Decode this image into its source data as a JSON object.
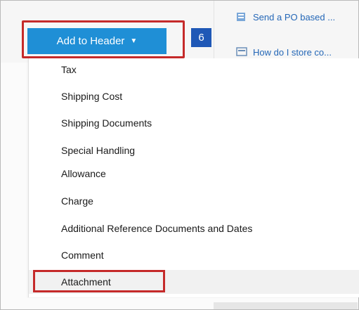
{
  "toolbar": {
    "add_to_header_label": "Add to Header",
    "caret_glyph": "▼",
    "step_number": "6"
  },
  "help_links": [
    {
      "label": "Send a PO based ...",
      "icon": "document-icon"
    },
    {
      "label": "How do I store co...",
      "icon": "image-icon"
    }
  ],
  "menu": {
    "items": [
      {
        "label": "Tax"
      },
      {
        "label": "Shipping Cost"
      },
      {
        "label": "Shipping Documents"
      },
      {
        "label": "Special Handling"
      },
      {
        "label": "Allowance"
      },
      {
        "label": "Charge"
      },
      {
        "label": "Additional Reference Documents and Dates"
      },
      {
        "label": "Comment"
      },
      {
        "label": "Attachment"
      }
    ]
  },
  "colors": {
    "button": "#1f8fd6",
    "badge": "#1f58b6",
    "highlight": "#c52a2a",
    "link": "#2467b7"
  }
}
